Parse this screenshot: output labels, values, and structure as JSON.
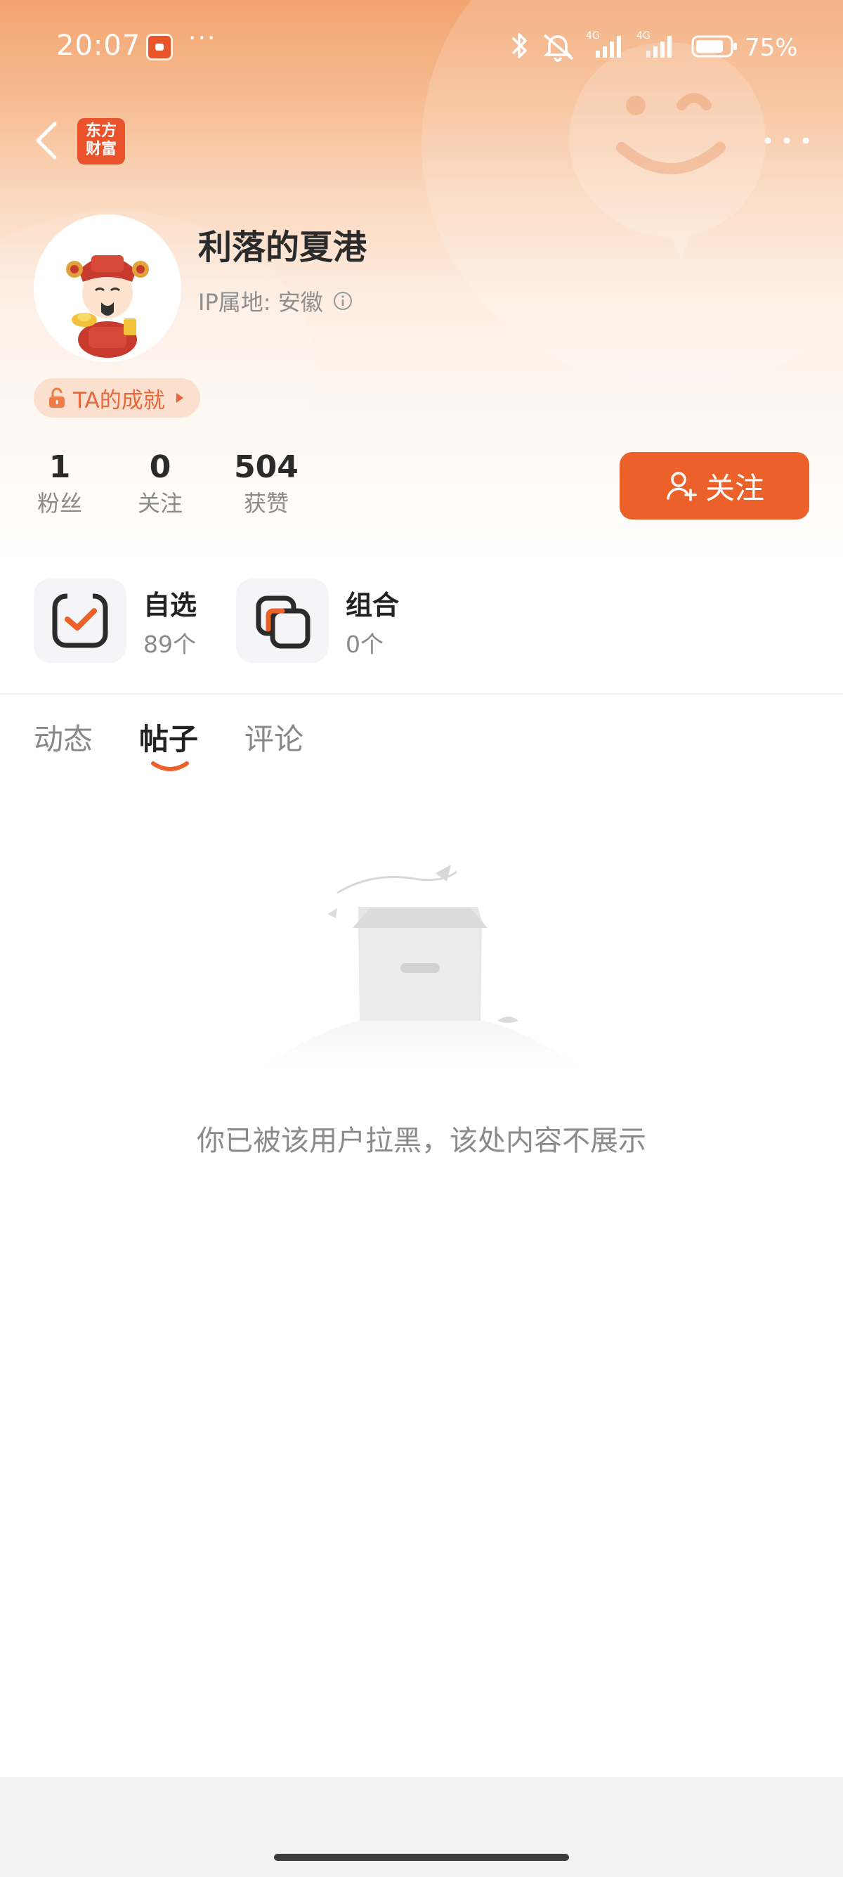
{
  "status_bar": {
    "time": "20:07",
    "more": "···",
    "network_1": "4G",
    "network_2": "4G",
    "battery": "75%"
  },
  "nav": {
    "logo_line1": "东方",
    "logo_line2": "财富"
  },
  "profile": {
    "username": "利落的夏港",
    "ip_location": "IP属地: 安徽",
    "achievement_label": "TA的成就",
    "follow_button": "关注",
    "stats": [
      {
        "value": "1",
        "label": "粉丝"
      },
      {
        "value": "0",
        "label": "关注"
      },
      {
        "value": "504",
        "label": "获赞"
      }
    ]
  },
  "shortcuts": [
    {
      "title": "自选",
      "count": "89个",
      "icon": "watchlist-icon"
    },
    {
      "title": "组合",
      "count": "0个",
      "icon": "portfolio-icon"
    }
  ],
  "tabs": [
    {
      "label": "动态",
      "active": false
    },
    {
      "label": "帖子",
      "active": true
    },
    {
      "label": "评论",
      "active": false
    }
  ],
  "empty_state": {
    "message": "你已被该用户拉黑，该处内容不展示"
  },
  "colors": {
    "accent": "#ec6129",
    "brand": "#e9522a"
  }
}
